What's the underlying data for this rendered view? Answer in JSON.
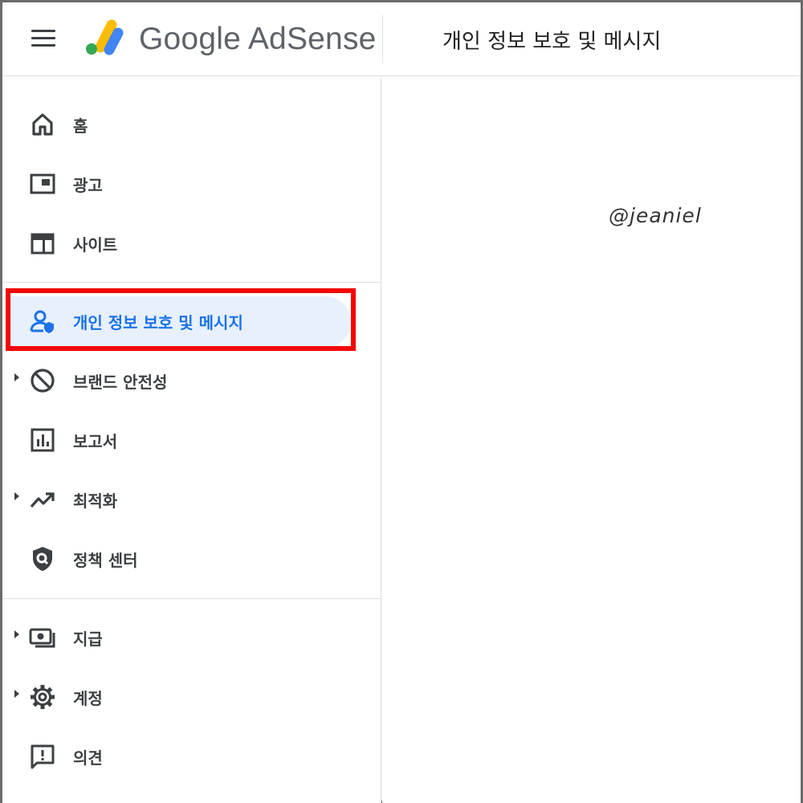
{
  "header": {
    "app_name": "Google AdSense",
    "page_title": "개인 정보 보호 및 메시지"
  },
  "sidebar": {
    "items": [
      {
        "label": "홈",
        "icon": "home-icon"
      },
      {
        "label": "광고",
        "icon": "ads-icon"
      },
      {
        "label": "사이트",
        "icon": "sites-icon"
      },
      {
        "label": "개인 정보 보호 및 메시지",
        "icon": "privacy-icon",
        "active": true
      },
      {
        "label": "브랜드 안전성",
        "icon": "block-icon",
        "expandable": true
      },
      {
        "label": "보고서",
        "icon": "reports-icon"
      },
      {
        "label": "최적화",
        "icon": "trending-up-icon",
        "expandable": true
      },
      {
        "label": "정책 센터",
        "icon": "policy-shield-icon"
      },
      {
        "label": "지급",
        "icon": "payments-icon",
        "expandable": true
      },
      {
        "label": "계정",
        "icon": "gear-icon",
        "expandable": true
      },
      {
        "label": "의견",
        "icon": "feedback-icon"
      }
    ]
  },
  "watermark": "@jeaniel",
  "colors": {
    "accent": "#1a73e8",
    "active_bg": "#e8f0fe",
    "highlight_border": "#f20707",
    "logo_yellow": "#fbbc04",
    "logo_blue": "#4285f4",
    "logo_green": "#34a853"
  }
}
